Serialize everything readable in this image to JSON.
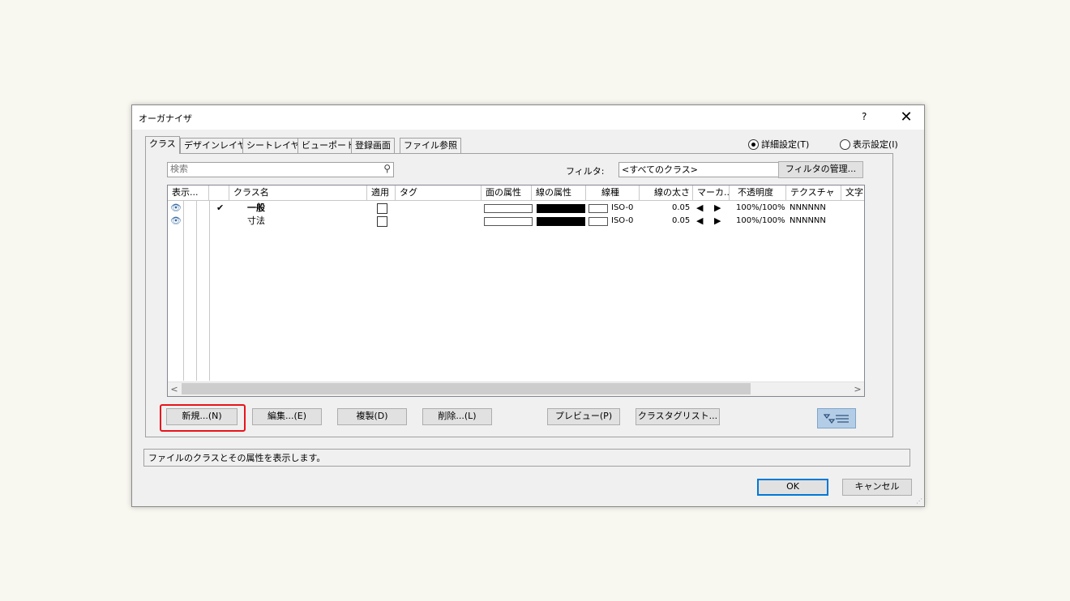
{
  "window": {
    "title": "オーガナイザ",
    "help": "?",
    "close": "✕"
  },
  "tabs": [
    "クラス",
    "デザインレイヤ",
    "シートレイヤ",
    "ビューポート",
    "登録画面",
    "ファイル参照"
  ],
  "view_mode": {
    "detail": "詳細設定(T)",
    "display": "表示設定(I)",
    "selected": "detail"
  },
  "search": {
    "placeholder": "検索"
  },
  "filter": {
    "label": "フィルタ:",
    "value": "<すべてのクラス>",
    "manage_button": "フィルタの管理..."
  },
  "table": {
    "columns": [
      "表示...",
      "",
      "クラス名",
      "適用",
      "タグ",
      "面の属性",
      "線の属性",
      "線種",
      "線の太さ",
      "マーカ...",
      "不透明度",
      "テクスチャ",
      "文字"
    ],
    "rows": [
      {
        "active": "✔",
        "name": "一般",
        "line_type": "ISO-0",
        "thickness": "0.05",
        "opacity": "100%/100%",
        "texture": "NNNNNN"
      },
      {
        "active": "",
        "name": "寸法",
        "line_type": "ISO-0",
        "thickness": "0.05",
        "opacity": "100%/100%",
        "texture": "NNNNNN"
      }
    ]
  },
  "buttons": {
    "new": "新規...(N)",
    "edit": "編集...(E)",
    "duplicate": "複製(D)",
    "delete": "削除...(L)",
    "preview": "プレビュー(P)",
    "class_tag_list": "クラスタグリスト..."
  },
  "status_text": "ファイルのクラスとその属性を表示します。",
  "footer": {
    "ok": "OK",
    "cancel": "キャンセル"
  },
  "colors": {
    "highlight": "#e8141b",
    "ok_border": "#0078d7"
  }
}
